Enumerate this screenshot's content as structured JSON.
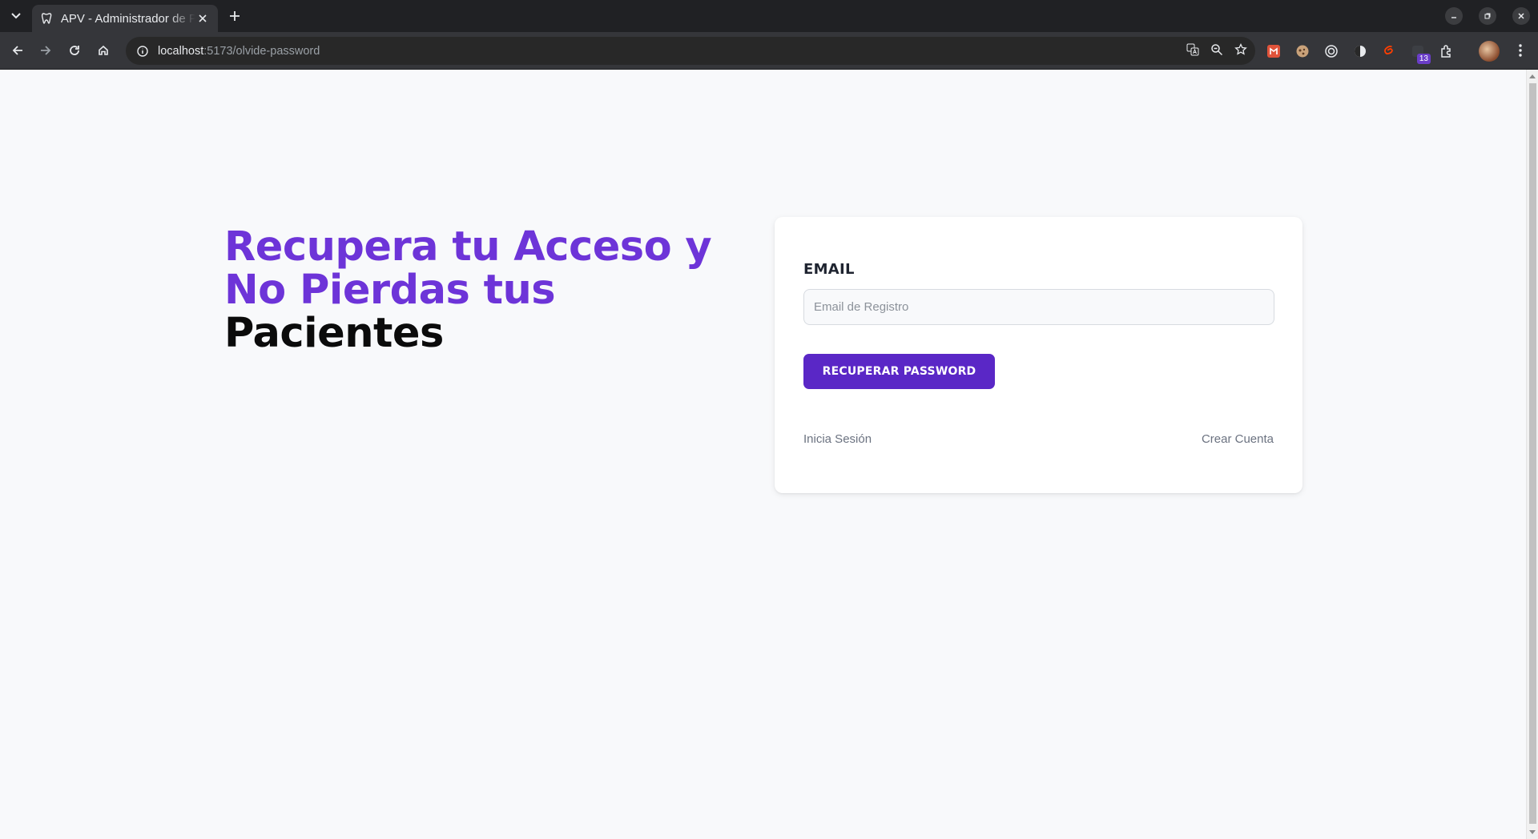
{
  "browser": {
    "tab_title": "APV - Administrador de Pacientes",
    "url_host": "localhost",
    "url_path": ":5173/olvide-password",
    "extension_badge": "13"
  },
  "hero": {
    "title_accent": "Recupera tu Acceso y No Pierdas tus",
    "title_dark": "Pacientes",
    "accent_color": "#6d34d8"
  },
  "form": {
    "email_label": "EMAIL",
    "email_placeholder": "Email de Registro",
    "email_value": "",
    "submit_label": "RECUPERAR PASSWORD",
    "button_color": "#5a27c6"
  },
  "links": {
    "login": "Inicia Sesión",
    "register": "Crear Cuenta"
  }
}
